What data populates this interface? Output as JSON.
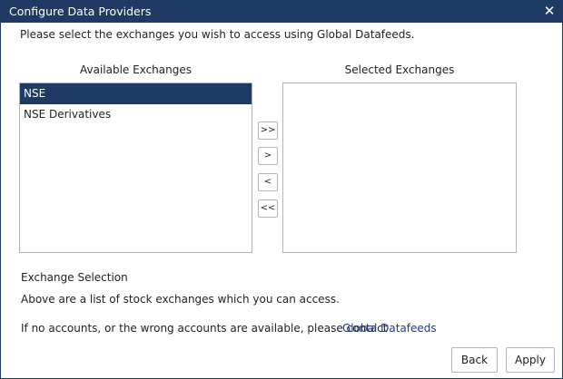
{
  "window": {
    "title": "Configure Data Providers",
    "close_glyph": "✕"
  },
  "instruction": "Please select the exchanges you wish to access using Global Datafeeds.",
  "available": {
    "label": "Available Exchanges",
    "items": [
      {
        "label": "NSE",
        "selected": true
      },
      {
        "label": "NSE Derivatives",
        "selected": false
      }
    ]
  },
  "selected": {
    "label": "Selected Exchanges",
    "items": []
  },
  "move_buttons": {
    "add_all": ">>",
    "add": ">",
    "remove": "<",
    "remove_all": "<<"
  },
  "info": {
    "heading": "Exchange Selection",
    "description": "Above are a list of stock exchanges which you can access.",
    "contact_text": "If no accounts, or the wrong accounts are available, please contact",
    "contact_link": "Global Datafeeds"
  },
  "footer": {
    "back_label": "Back",
    "apply_label": "Apply"
  },
  "colors": {
    "accent": "#1f3b63",
    "link": "#1f3b8a",
    "border": "#b4b4b4"
  }
}
